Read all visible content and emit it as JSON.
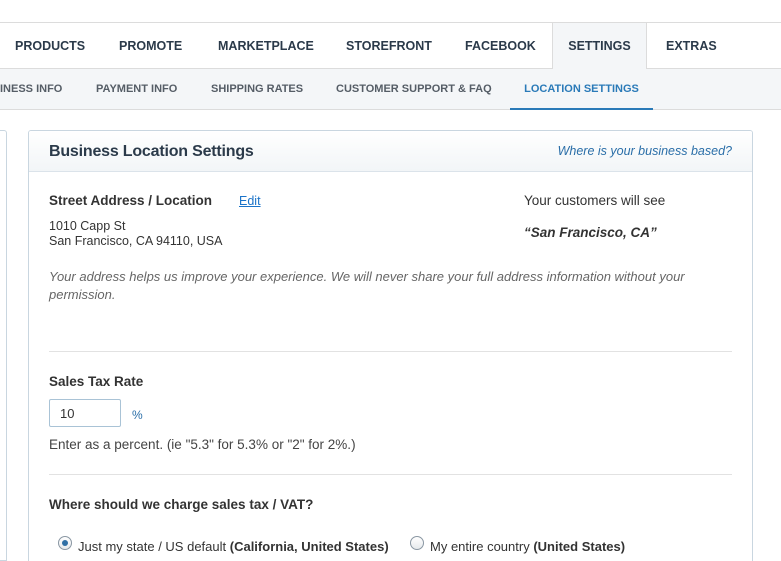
{
  "main_nav": {
    "tabs": [
      {
        "label": "PRODUCTS",
        "active": false
      },
      {
        "label": "PROMOTE",
        "active": false
      },
      {
        "label": "MARKETPLACE",
        "active": false
      },
      {
        "label": "STOREFRONT",
        "active": false
      },
      {
        "label": "FACEBOOK",
        "active": false
      },
      {
        "label": "SETTINGS",
        "active": true
      },
      {
        "label": "EXTRAS",
        "active": false
      }
    ]
  },
  "sub_nav": {
    "tabs": [
      {
        "label": "INESS INFO",
        "active": false
      },
      {
        "label": "PAYMENT INFO",
        "active": false
      },
      {
        "label": "SHIPPING RATES",
        "active": false
      },
      {
        "label": "CUSTOMER SUPPORT & FAQ",
        "active": false
      },
      {
        "label": "LOCATION SETTINGS",
        "active": true
      }
    ]
  },
  "panel": {
    "title": "Business Location Settings",
    "hint": "Where is your business based?"
  },
  "address": {
    "label": "Street Address / Location",
    "edit_label": "Edit",
    "line1": "1010 Capp St",
    "line2": "San Francisco, CA 94110, USA",
    "customers_see_label": "Your customers will see",
    "customers_see_value": "“San Francisco, CA”",
    "note": "Your address helps us improve your experience. We will never share your full address information without your permission."
  },
  "sales_tax": {
    "label": "Sales Tax Rate",
    "value": "10",
    "unit": "%",
    "helper": "Enter as a percent. (ie \"5.3\" for 5.3% or \"2\" for 2%.)"
  },
  "charge_where": {
    "label": "Where should we charge sales tax / VAT?",
    "options": [
      {
        "text": "Just my state / US default",
        "bold": "(California, United States)",
        "checked": true
      },
      {
        "text": "My entire country",
        "bold": "(United States)",
        "checked": false
      }
    ]
  },
  "colors": {
    "accent": "#2a7ab8",
    "link": "#1a73c9",
    "nav_text": "#2b3a4a",
    "border": "#c9d6e0"
  }
}
